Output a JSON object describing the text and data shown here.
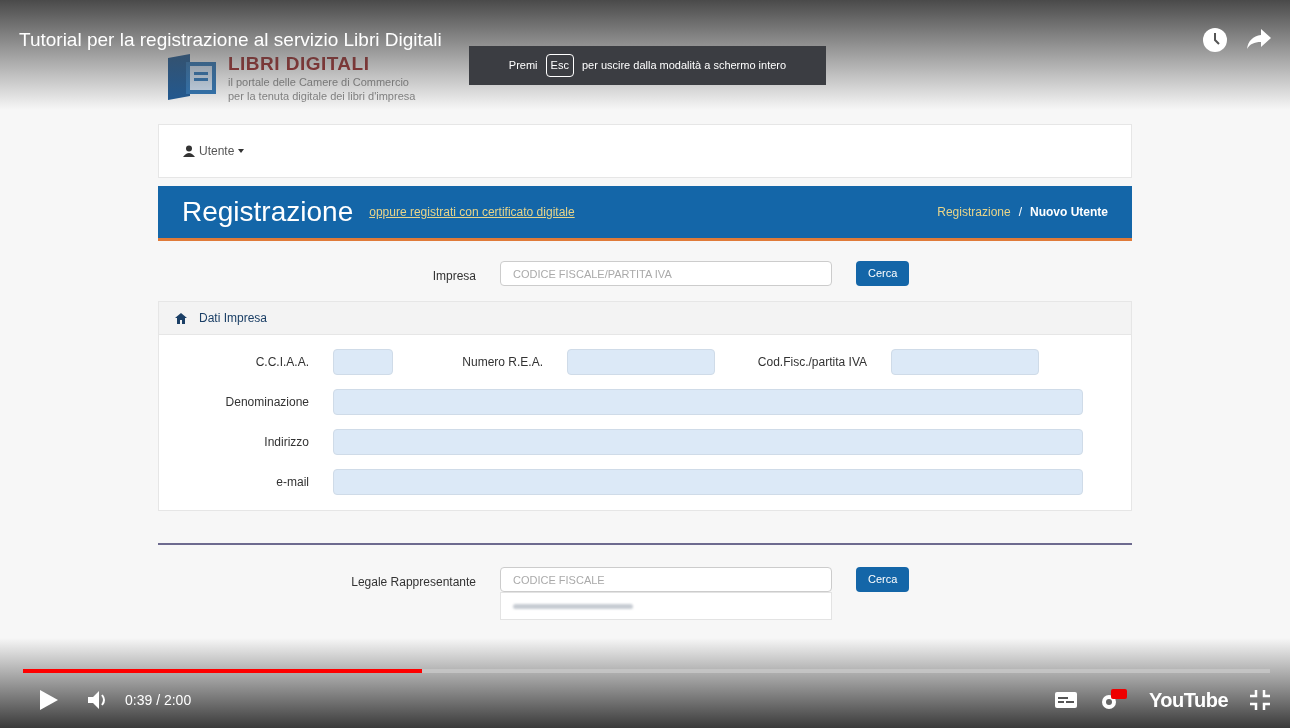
{
  "player": {
    "title": "Tutorial per la registrazione al servizio Libri Digitali",
    "tooltip": {
      "before": "Premi",
      "key": "Esc",
      "after": "per uscire dalla modalità a schermo intero"
    },
    "progress": {
      "level": 0.32
    },
    "time": "0:39 / 2:00",
    "logo": "YouTube"
  },
  "site": {
    "logo_title": "LIBRI DIGITALI",
    "logo_subtitle": [
      "il portale delle Camere di Commercio",
      "per la tenuta digitale dei libri d'impresa"
    ],
    "user_menu": "Utente",
    "header": {
      "title": "Registrazione",
      "link": "oppure registrati con certificato digitale",
      "breadcrumb": [
        "Registrazione",
        "Nuovo Utente"
      ],
      "separator": "/"
    },
    "impresa_search": {
      "label": "Impresa",
      "placeholder": "CODICE FISCALE/PARTITA IVA",
      "button": "Cerca"
    },
    "panel": {
      "title": "Dati Impresa",
      "rows": [
        {
          "fields": [
            {
              "label": "C.C.I.A.A."
            },
            {
              "label": "Numero R.E.A."
            },
            {
              "label": "Cod.Fisc./partita IVA"
            }
          ]
        },
        {
          "fields": [
            {
              "label": "Denominazione"
            }
          ]
        },
        {
          "fields": [
            {
              "label": "Indirizzo"
            }
          ]
        },
        {
          "fields": [
            {
              "label": "e-mail"
            }
          ]
        }
      ]
    },
    "legale_search": {
      "label": "Legale Rappresentante",
      "placeholder": "CODICE FISCALE",
      "button": "Cerca"
    }
  }
}
